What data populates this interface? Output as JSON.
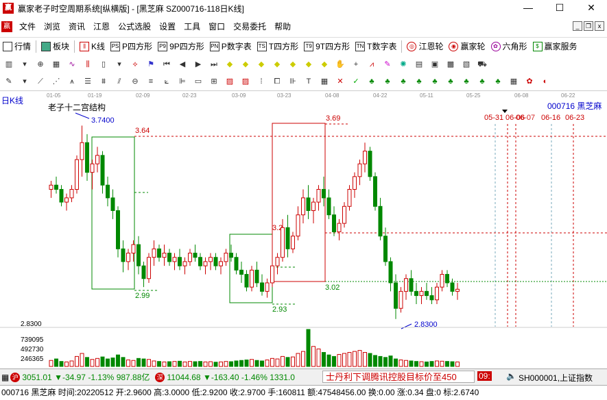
{
  "window": {
    "title": "赢家老子时空周期系统[纵横版] - [黑芝麻  SZ000716-118日K线]",
    "app_icon": "赢"
  },
  "menu": [
    "文件",
    "浏览",
    "资讯",
    "江恩",
    "公式选股",
    "设置",
    "工具",
    "窗口",
    "交易委托",
    "帮助"
  ],
  "toolbar1": [
    {
      "icon": "grid",
      "label": "行情"
    },
    {
      "icon": "blocks",
      "label": "板块"
    },
    {
      "icon": "k",
      "label": "K线"
    },
    {
      "icon": "PS",
      "label": "P四方形"
    },
    {
      "icon": "P9",
      "label": "9P四方形"
    },
    {
      "icon": "PN",
      "label": "P数字表"
    },
    {
      "icon": "TS",
      "label": "T四方形"
    },
    {
      "icon": "T9",
      "label": "9T四方形"
    },
    {
      "icon": "TN",
      "label": "T数字表"
    },
    {
      "icon": "G",
      "label": "江恩轮"
    },
    {
      "icon": "Y",
      "label": "赢家轮"
    },
    {
      "icon": "6",
      "label": "六角形"
    },
    {
      "icon": "$",
      "label": "赢家服务"
    }
  ],
  "chart": {
    "label": "日K线",
    "structure_title": "老子十二宫结构",
    "stock": "000716  黑芝麻",
    "dates": [
      "01-05",
      "01-19",
      "02-09",
      "02-23",
      "03-09",
      "03-23",
      "04-08",
      "04-22",
      "05-11",
      "05-25",
      "06-08",
      "06-22"
    ],
    "marks": [
      "3.7400",
      "3.64",
      "2.99",
      "3.69",
      "3.02",
      "2.93",
      "2.8300"
    ],
    "future_dates": [
      "05-31",
      "06-06",
      "06-07",
      "06-16",
      "06-23"
    ],
    "price_axis": [
      "2.8300"
    ],
    "volume_axis": [
      "739095",
      "492730",
      "246365"
    ],
    "volume_marker": "3.2"
  },
  "status1": {
    "sh": "3051.01",
    "sh_change": "▼-34.97",
    "sh_pct": "-1.13%",
    "sh_amt": "987.88亿",
    "sz": "11044.68",
    "sz_change": "▼-163.40",
    "sz_pct": "-1.46%",
    "sz_amt": "1331.0",
    "news": "士丹利下调腾讯控股目标价至450",
    "time": "09:",
    "index": "SH000001,上证指数"
  },
  "status2": "000716 黑芝麻 时间:20220512 开:2.9600 高:3.0000 低:2.9200 收:2.9700 手:160811 额:47548456.00 换:0.00 涨:0.34 盘:0 标:2.6740",
  "chart_data": {
    "type": "candlestick",
    "candles": [
      [
        3.44,
        3.48,
        3.4,
        3.46
      ],
      [
        3.46,
        3.5,
        3.42,
        3.44
      ],
      [
        3.44,
        3.46,
        3.36,
        3.38
      ],
      [
        3.38,
        3.42,
        3.34,
        3.4
      ],
      [
        3.4,
        3.46,
        3.38,
        3.44
      ],
      [
        3.44,
        3.6,
        3.42,
        3.58
      ],
      [
        3.58,
        3.74,
        3.5,
        3.66
      ],
      [
        3.66,
        3.7,
        3.48,
        3.52
      ],
      [
        3.52,
        3.58,
        3.44,
        3.56
      ],
      [
        3.56,
        3.64,
        3.52,
        3.6
      ],
      [
        3.6,
        3.62,
        3.42,
        3.46
      ],
      [
        3.46,
        3.5,
        3.36,
        3.4
      ],
      [
        3.4,
        3.44,
        3.3,
        3.34
      ],
      [
        3.34,
        3.36,
        3.12,
        3.16
      ],
      [
        3.16,
        3.2,
        3.05,
        3.1
      ],
      [
        3.1,
        3.16,
        3.06,
        3.14
      ],
      [
        3.14,
        3.2,
        3.1,
        3.18
      ],
      [
        3.18,
        3.22,
        3.04,
        3.08
      ],
      [
        3.08,
        3.1,
        2.98,
        3.02
      ],
      [
        3.02,
        3.14,
        3.0,
        3.12
      ],
      [
        3.12,
        3.2,
        3.08,
        3.16
      ],
      [
        3.16,
        3.18,
        3.1,
        3.12
      ],
      [
        3.12,
        3.18,
        3.08,
        3.14
      ],
      [
        3.14,
        3.16,
        3.08,
        3.1
      ],
      [
        3.1,
        3.14,
        3.06,
        3.12
      ],
      [
        3.12,
        3.16,
        3.06,
        3.08
      ],
      [
        3.08,
        3.12,
        3.04,
        3.1
      ],
      [
        3.1,
        3.16,
        3.08,
        3.14
      ],
      [
        3.14,
        3.18,
        3.1,
        3.12
      ],
      [
        3.12,
        3.14,
        3.06,
        3.08
      ],
      [
        3.08,
        3.12,
        3.04,
        3.1
      ],
      [
        3.1,
        3.14,
        3.06,
        3.12
      ],
      [
        3.12,
        3.14,
        3.06,
        3.08
      ],
      [
        3.08,
        3.12,
        3.04,
        3.1
      ],
      [
        3.1,
        3.16,
        3.08,
        3.14
      ],
      [
        3.14,
        3.18,
        3.1,
        3.12
      ],
      [
        3.12,
        3.14,
        3.04,
        3.06
      ],
      [
        3.06,
        3.1,
        3.0,
        3.04
      ],
      [
        3.04,
        3.06,
        2.96,
        2.98
      ],
      [
        2.98,
        3.08,
        2.96,
        3.06
      ],
      [
        3.06,
        3.1,
        2.98,
        3.0
      ],
      [
        3.0,
        3.04,
        2.94,
        2.96
      ],
      [
        2.96,
        3.02,
        2.93,
        3.0
      ],
      [
        3.0,
        3.1,
        2.98,
        3.08
      ],
      [
        3.08,
        3.14,
        3.04,
        3.12
      ],
      [
        3.12,
        3.3,
        3.1,
        3.26
      ],
      [
        3.26,
        3.32,
        3.12,
        3.16
      ],
      [
        3.16,
        3.24,
        3.14,
        3.22
      ],
      [
        3.22,
        3.36,
        3.2,
        3.32
      ],
      [
        3.32,
        3.44,
        3.28,
        3.4
      ],
      [
        3.4,
        3.46,
        3.3,
        3.34
      ],
      [
        3.34,
        3.4,
        3.28,
        3.38
      ],
      [
        3.38,
        3.46,
        3.34,
        3.44
      ],
      [
        3.44,
        3.5,
        3.36,
        3.4
      ],
      [
        3.4,
        3.44,
        3.3,
        3.32
      ],
      [
        3.32,
        3.36,
        3.22,
        3.24
      ],
      [
        3.24,
        3.3,
        3.2,
        3.28
      ],
      [
        3.28,
        3.38,
        3.26,
        3.36
      ],
      [
        3.36,
        3.46,
        3.34,
        3.44
      ],
      [
        3.44,
        3.52,
        3.4,
        3.5
      ],
      [
        3.5,
        3.58,
        3.46,
        3.56
      ],
      [
        3.56,
        3.66,
        3.52,
        3.62
      ],
      [
        3.62,
        3.64,
        3.48,
        3.5
      ],
      [
        3.5,
        3.52,
        3.34,
        3.36
      ],
      [
        3.36,
        3.4,
        3.2,
        3.22
      ],
      [
        3.22,
        3.26,
        3.08,
        3.1
      ],
      [
        3.1,
        3.12,
        2.96,
        3.0
      ],
      [
        3.0,
        3.04,
        2.83,
        2.88
      ],
      [
        2.88,
        2.98,
        2.86,
        2.96
      ],
      [
        2.96,
        3.04,
        2.92,
        3.02
      ],
      [
        3.02,
        3.06,
        2.94,
        2.96
      ],
      [
        2.96,
        3.0,
        2.9,
        2.94
      ],
      [
        2.94,
        2.98,
        2.9,
        2.96
      ],
      [
        2.96,
        3.0,
        2.92,
        2.94
      ],
      [
        2.94,
        2.98,
        2.9,
        2.92
      ],
      [
        2.92,
        3.0,
        2.9,
        2.98
      ],
      [
        2.98,
        3.06,
        2.96,
        3.04
      ],
      [
        3.04,
        3.06,
        2.98,
        3.0
      ],
      [
        3.0,
        3.02,
        2.94,
        2.96
      ],
      [
        2.96,
        3.0,
        2.92,
        2.97
      ]
    ],
    "volumes": [
      120000,
      150000,
      100000,
      90000,
      110000,
      200000,
      260000,
      180000,
      140000,
      160000,
      190000,
      150000,
      170000,
      230000,
      180000,
      130000,
      120000,
      160000,
      150000,
      140000,
      110000,
      100000,
      90000,
      95000,
      100000,
      105000,
      90000,
      100000,
      95000,
      100000,
      90000,
      95000,
      85000,
      90000,
      100000,
      95000,
      110000,
      120000,
      130000,
      140000,
      120000,
      110000,
      130000,
      160000,
      150000,
      200000,
      180000,
      190000,
      260000,
      300000,
      739095,
      400000,
      350000,
      280000,
      230000,
      200000,
      240000,
      260000,
      280000,
      300000,
      320000,
      280000,
      260000,
      220000,
      200000,
      180000,
      210000,
      150000,
      130000,
      120000,
      110000,
      100000,
      95000,
      90000,
      100000,
      110000,
      105000,
      100000,
      95000,
      90000
    ]
  }
}
